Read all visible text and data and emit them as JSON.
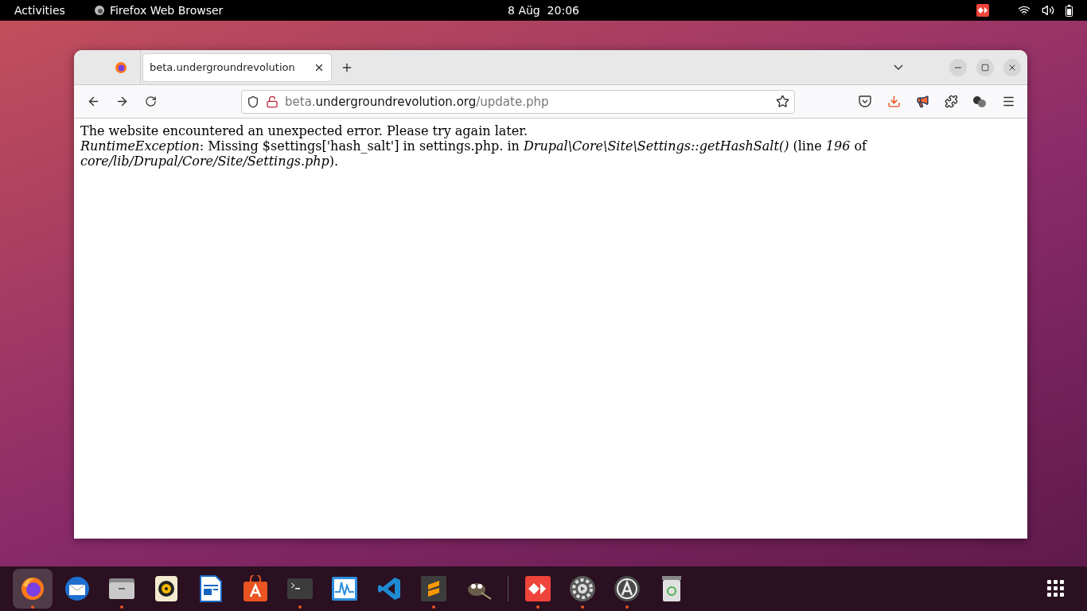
{
  "top_bar": {
    "activities": "Activities",
    "app_name": "Firefox Web Browser",
    "clock": "8 Aüg  20:06"
  },
  "browser": {
    "tabs": [
      {
        "title": "beta.undergroundrevolution",
        "selected": true
      }
    ],
    "url": {
      "prefix": "beta.",
      "host": "undergroundrevolution.org",
      "path": "/update.php"
    },
    "page": {
      "message": "The website encountered an unexpected error. Please try again later.",
      "error": "*RuntimeException*: Missing $settings['hash_salt'] in settings.php. in *Drupal\\Core\\Site\\Settings::getHashSalt()* (line *196* of *core/lib/Drupal/Core/Site/Settings.php*)."
    }
  },
  "dock": [
    {
      "kind": "firefox",
      "selected": true,
      "running": true
    },
    {
      "kind": "mail",
      "selected": false,
      "running": false
    },
    {
      "kind": "files",
      "selected": false,
      "running": true
    },
    {
      "kind": "music",
      "selected": false,
      "running": false
    },
    {
      "kind": "writer",
      "selected": false,
      "running": false
    },
    {
      "kind": "store",
      "selected": false,
      "running": false
    },
    {
      "kind": "terminal",
      "selected": false,
      "running": true
    },
    {
      "kind": "monitor",
      "selected": false,
      "running": false
    },
    {
      "kind": "code",
      "selected": false,
      "running": false
    },
    {
      "kind": "sublime",
      "selected": false,
      "running": true
    },
    {
      "kind": "gimp",
      "selected": false,
      "running": false
    },
    {
      "kind": "separator"
    },
    {
      "kind": "remote",
      "selected": false,
      "running": true
    },
    {
      "kind": "settings",
      "selected": false,
      "running": true
    },
    {
      "kind": "updater",
      "selected": false,
      "running": true
    },
    {
      "kind": "trash",
      "selected": false,
      "running": false
    }
  ]
}
